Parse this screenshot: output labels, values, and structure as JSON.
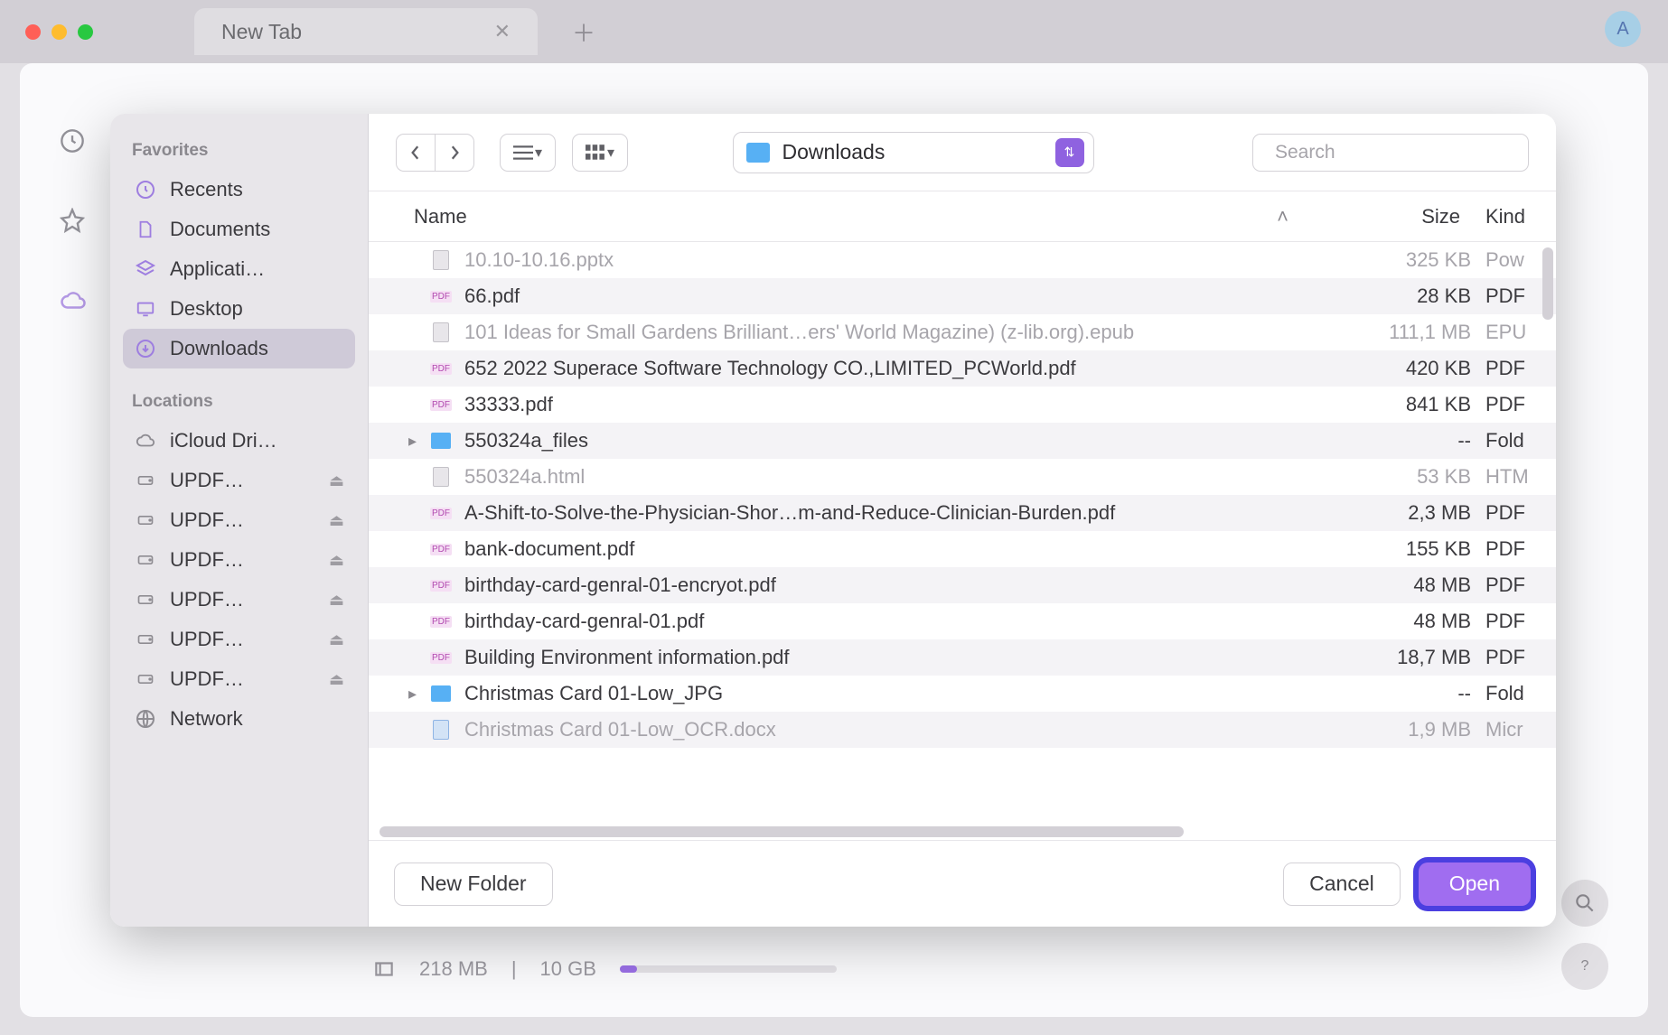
{
  "browser": {
    "tab_title": "New Tab",
    "avatar_letter": "A"
  },
  "dialog": {
    "sidebar": {
      "favorites_header": "Favorites",
      "favorites": [
        {
          "icon": "clock",
          "label": "Recents"
        },
        {
          "icon": "doc",
          "label": "Documents"
        },
        {
          "icon": "app",
          "label": "Applicati…"
        },
        {
          "icon": "desktop",
          "label": "Desktop"
        },
        {
          "icon": "download",
          "label": "Downloads",
          "selected": true
        }
      ],
      "locations_header": "Locations",
      "locations": [
        {
          "icon": "cloud",
          "label": "iCloud Dri…"
        },
        {
          "icon": "disk",
          "label": "UPDF…",
          "eject": true
        },
        {
          "icon": "disk",
          "label": "UPDF…",
          "eject": true
        },
        {
          "icon": "disk",
          "label": "UPDF…",
          "eject": true
        },
        {
          "icon": "disk",
          "label": "UPDF…",
          "eject": true
        },
        {
          "icon": "disk",
          "label": "UPDF…",
          "eject": true
        },
        {
          "icon": "disk",
          "label": "UPDF…",
          "eject": true
        },
        {
          "icon": "globe",
          "label": "Network"
        }
      ]
    },
    "location_label": "Downloads",
    "search_placeholder": "Search",
    "columns": {
      "name": "Name",
      "size": "Size",
      "kind": "Kind"
    },
    "files": [
      {
        "icon": "pptx",
        "name": "10.10-10.16.pptx",
        "size": "325 KB",
        "kind": "Pow",
        "dim": true
      },
      {
        "icon": "pdf",
        "name": "66.pdf",
        "size": "28 KB",
        "kind": "PDF"
      },
      {
        "icon": "epub",
        "name": "101 Ideas for Small Gardens Brilliant…ers' World Magazine) (z-lib.org).epub",
        "size": "111,1 MB",
        "kind": "EPU",
        "dim": true
      },
      {
        "icon": "pdf",
        "name": "652 2022 Superace Software Technology CO.,LIMITED_PCWorld.pdf",
        "size": "420 KB",
        "kind": "PDF"
      },
      {
        "icon": "pdf",
        "name": "33333.pdf",
        "size": "841 KB",
        "kind": "PDF"
      },
      {
        "icon": "folder",
        "name": "550324a_files",
        "size": "--",
        "kind": "Fold",
        "folder": true
      },
      {
        "icon": "html",
        "name": "550324a.html",
        "size": "53 KB",
        "kind": "HTM",
        "dim": true
      },
      {
        "icon": "pdf",
        "name": "A-Shift-to-Solve-the-Physician-Shor…m-and-Reduce-Clinician-Burden.pdf",
        "size": "2,3 MB",
        "kind": "PDF"
      },
      {
        "icon": "pdf",
        "name": "bank-document.pdf",
        "size": "155 KB",
        "kind": "PDF"
      },
      {
        "icon": "pdf",
        "name": "birthday-card-genral-01-encryot.pdf",
        "size": "48 MB",
        "kind": "PDF"
      },
      {
        "icon": "pdf",
        "name": "birthday-card-genral-01.pdf",
        "size": "48 MB",
        "kind": "PDF"
      },
      {
        "icon": "pdf",
        "name": "Building Environment information.pdf",
        "size": "18,7 MB",
        "kind": "PDF"
      },
      {
        "icon": "folder",
        "name": "Christmas Card 01-Low_JPG",
        "size": "--",
        "kind": "Fold",
        "folder": true
      },
      {
        "icon": "docx",
        "name": "Christmas Card 01-Low_OCR.docx",
        "size": "1,9 MB",
        "kind": "Micr",
        "dim": true
      }
    ],
    "footer": {
      "new_folder": "New Folder",
      "cancel": "Cancel",
      "open": "Open"
    }
  },
  "status": {
    "used": "218 MB",
    "total": "10 GB"
  }
}
